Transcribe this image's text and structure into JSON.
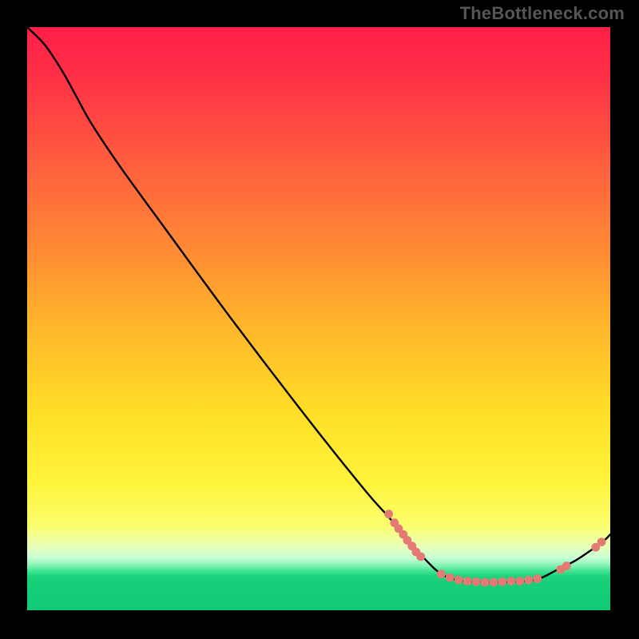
{
  "watermark": "TheBottleneck.com",
  "colors": {
    "dot": "#e47a74",
    "curve": "#000000"
  },
  "chart_data": {
    "note": "Axes are unlabeled in the source image; x and y are normalized 0–100 fractions of the plot-area width and height (y measured from the top edge down, i.e. y=0 at top, y=100 at bottom). The curve descends steeply from top-left, flattens into a green trough ~x=72–88, then rises slightly at the right.",
    "type": "line",
    "x_range_normalized": [
      0,
      100
    ],
    "y_range_normalized_top_down": [
      0,
      100
    ],
    "series": [
      {
        "name": "bottleneck-curve",
        "interpretation": "lower = better (green zone ≈ y 93–96)",
        "points": [
          {
            "x": 0.0,
            "y": 0.0
          },
          {
            "x": 3.0,
            "y": 3.0
          },
          {
            "x": 6.0,
            "y": 7.5
          },
          {
            "x": 8.5,
            "y": 12.0
          },
          {
            "x": 11.0,
            "y": 16.5
          },
          {
            "x": 16.0,
            "y": 24.0
          },
          {
            "x": 24.0,
            "y": 35.0
          },
          {
            "x": 35.0,
            "y": 50.0
          },
          {
            "x": 48.0,
            "y": 67.0
          },
          {
            "x": 58.0,
            "y": 79.5
          },
          {
            "x": 62.0,
            "y": 84.0
          },
          {
            "x": 64.0,
            "y": 86.5
          },
          {
            "x": 66.0,
            "y": 89.0
          },
          {
            "x": 68.0,
            "y": 91.0
          },
          {
            "x": 70.0,
            "y": 93.0
          },
          {
            "x": 72.0,
            "y": 94.3
          },
          {
            "x": 75.0,
            "y": 95.0
          },
          {
            "x": 80.0,
            "y": 95.2
          },
          {
            "x": 85.0,
            "y": 95.0
          },
          {
            "x": 88.0,
            "y": 94.5
          },
          {
            "x": 91.0,
            "y": 93.0
          },
          {
            "x": 94.0,
            "y": 91.5
          },
          {
            "x": 97.0,
            "y": 89.5
          },
          {
            "x": 99.0,
            "y": 88.0
          },
          {
            "x": 100.0,
            "y": 87.0
          }
        ]
      }
    ],
    "markers": [
      {
        "name": "descent-cluster-upper",
        "approx_x": 62.0,
        "approx_y": 83.5
      },
      {
        "name": "descent-cluster-2",
        "approx_x": 63.0,
        "approx_y": 85.0
      },
      {
        "name": "descent-cluster-3",
        "approx_x": 63.7,
        "approx_y": 86.0
      },
      {
        "name": "descent-cluster-4",
        "approx_x": 64.5,
        "approx_y": 87.0
      },
      {
        "name": "descent-cluster-5",
        "approx_x": 65.2,
        "approx_y": 88.0
      },
      {
        "name": "descent-cluster-6",
        "approx_x": 66.0,
        "approx_y": 89.0
      },
      {
        "name": "descent-cluster-7",
        "approx_x": 66.7,
        "approx_y": 90.0
      },
      {
        "name": "descent-cluster-lower",
        "approx_x": 67.5,
        "approx_y": 90.8
      },
      {
        "name": "trough-1",
        "approx_x": 71.0,
        "approx_y": 93.8
      },
      {
        "name": "trough-2",
        "approx_x": 72.5,
        "approx_y": 94.4
      },
      {
        "name": "trough-3",
        "approx_x": 74.0,
        "approx_y": 94.8
      },
      {
        "name": "trough-4",
        "approx_x": 75.5,
        "approx_y": 95.0
      },
      {
        "name": "trough-5",
        "approx_x": 77.0,
        "approx_y": 95.1
      },
      {
        "name": "trough-6",
        "approx_x": 78.5,
        "approx_y": 95.2
      },
      {
        "name": "trough-7",
        "approx_x": 80.0,
        "approx_y": 95.2
      },
      {
        "name": "trough-8",
        "approx_x": 81.5,
        "approx_y": 95.1
      },
      {
        "name": "trough-9",
        "approx_x": 83.0,
        "approx_y": 95.0
      },
      {
        "name": "trough-10",
        "approx_x": 84.5,
        "approx_y": 95.0
      },
      {
        "name": "trough-11",
        "approx_x": 86.0,
        "approx_y": 94.8
      },
      {
        "name": "trough-12",
        "approx_x": 87.5,
        "approx_y": 94.6
      },
      {
        "name": "right-rise-1",
        "approx_x": 91.5,
        "approx_y": 93.0
      },
      {
        "name": "right-rise-2",
        "approx_x": 92.5,
        "approx_y": 92.4
      },
      {
        "name": "right-tip-1",
        "approx_x": 97.5,
        "approx_y": 89.2
      },
      {
        "name": "right-tip-2",
        "approx_x": 98.5,
        "approx_y": 88.3
      }
    ],
    "marker_radius_px": 5.4
  }
}
